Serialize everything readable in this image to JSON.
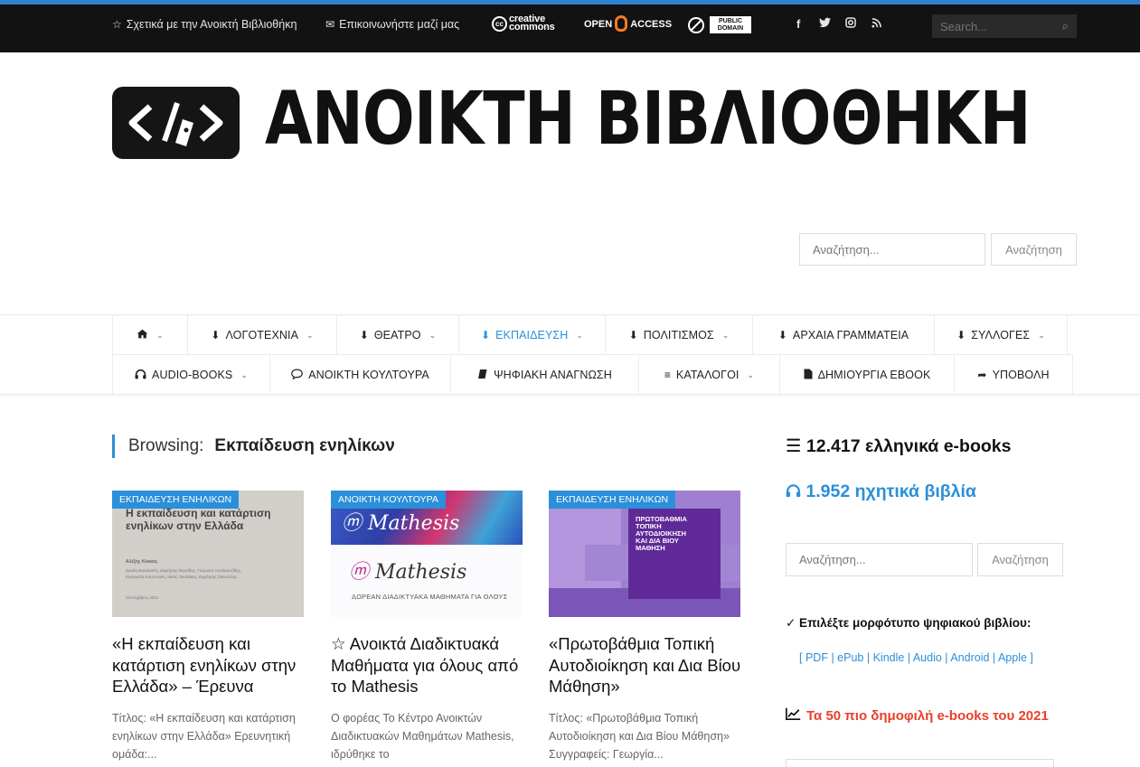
{
  "topbar": {
    "about_label": "Σχετικά με την Ανοικτή Βιβλιοθήκη",
    "contact_label": "Επικοινωνήστε μαζί μας",
    "cc_badge_line1": "creative",
    "cc_badge_line2": "commons",
    "cc_badge_symbol": "cc",
    "oa_badge_left": "OPEN",
    "oa_badge_right": "ACCESS",
    "pd_badge_line1": "PUBLIC",
    "pd_badge_line2": "DOMAIN",
    "social": [
      "f",
      "twitter-bird",
      "instagram",
      "rss"
    ],
    "search_placeholder": "Search..."
  },
  "logo": {
    "title": "ΑΝΟΙΚΤΗ ΒΙΒΛΙΟΘΗΚΗ"
  },
  "header_search": {
    "placeholder": "Αναζήτηση...",
    "button": "Αναζήτηση"
  },
  "nav": {
    "row1": [
      "ΛΟΓΟΤΕΧΝΙΑ",
      "ΘΕΑΤΡΟ",
      "ΕΚΠΑΙΔΕΥΣΗ",
      "ΠΟΛΙΤΙΣΜΟΣ",
      "ΑΡΧΑΙΑ ΓΡΑΜΜΑΤΕΙΑ",
      "ΣΥΛΛΟΓΕΣ"
    ],
    "row2": [
      "AUDIO-BOOKS",
      "ΑΝΟΙΚΤΗ ΚΟΥΛΤΟΥΡΑ",
      "ΨΗΦΙΑΚΗ ΑΝΑΓΝΩΣΗ",
      "ΚΑΤΑΛΟΓΟΙ",
      "ΔΗΜΙΟΥΡΓΙΑ EBOOK",
      "ΥΠΟΒΟΛΗ"
    ],
    "active": "ΕΚΠΑΙΔΕΥΣΗ",
    "accent_color": "#2b8fd9"
  },
  "browsing": {
    "prefix": "Browsing:",
    "term": "Εκπαίδευση ενηλίκων"
  },
  "cards": [
    {
      "category": "ΕΚΠΑΙΔΕΥΣΗ ΕΝΗΛΙΚΩΝ",
      "cover_title": "Η εκπαίδευση και κατάρτιση ενηλίκων στην Ελλάδα",
      "cover_authors_line1": "Αλέξης Κόκκος",
      "cover_authors_line2": "Δανάη Βασιλειάτη, Δημήτρης Βεργίδης, Γεώργιος Κουλαουζίδης,",
      "cover_authors_line3": "Ευαγγελία Κουτσούκη, Νίκος Παυλάκης, Δημήτρης Σακκούλης",
      "cover_date": "Σεπτέμβριος 2021",
      "title": "«Η εκπαίδευση και κατάρτιση ενηλίκων στην Ελλάδα» – Έρευνα",
      "excerpt": "Τίτλος: «Η εκπαίδευση και κατάρτιση ενηλίκων στην Ελλάδα» Ερευνητική ομάδα:..."
    },
    {
      "category": "ΑΝΟΙΚΤΗ ΚΟΥΛΤΟΥΡΑ",
      "cover_brand": "Mathesis",
      "cover_caption": "ΔΩΡΕΑΝ ΔΙΑΔΙΚΤΥΑΚΑ ΜΑΘΗΜΑΤΑ ΓΙΑ ΟΛΟΥΣ",
      "title": "☆ Ανοικτά Διαδικτυακά Μαθήματα για όλους από το Mathesis",
      "excerpt": "Ο φορέας Το Κέντρο Ανοικτών Διαδικτυακών Μαθημάτων Mathesis, ιδρύθηκε το"
    },
    {
      "category": "ΕΚΠΑΙΔΕΥΣΗ ΕΝΗΛΙΚΩΝ",
      "cover_line1": "ΠΡΩΤΟΒΑΘΜΙΑ",
      "cover_line2": "ΤΟΠΙΚΗ",
      "cover_line3": "ΑΥΤΟΔΙΟΙΚΗΣΗ",
      "cover_line4": "ΚΑΙ ΔΙΑ ΒΙΟΥ",
      "cover_line5": "ΜΑΘΗΣΗ",
      "title": "«Πρωτοβάθμια Τοπική Αυτοδιοίκηση και Δια Βίου Μάθηση»",
      "excerpt": "Τίτλος: «Πρωτοβάθμια Τοπική Αυτοδιοίκηση και Δια Βίου Μάθηση» Συγγραφείς: Γεωργία..."
    }
  ],
  "sidebar": {
    "ebooks_count": "12.417 ελληνικά e-books",
    "audio_count": "1.952 ηχητικά βιβλία",
    "search_placeholder": "Αναζήτηση...",
    "search_button": "Αναζήτηση",
    "format_prompt": "✓ Επιλέξτε μορφότυπο ψηφιακού βιβλίου:",
    "format_open": "[",
    "formats": [
      "PDF",
      "ePub",
      "Kindle",
      "Audio",
      "Android",
      "Apple"
    ],
    "format_close": "]",
    "popular_title": "Τα 50 πιο δημοφιλή e-books του 2021",
    "popular_color": "#e8402b"
  }
}
